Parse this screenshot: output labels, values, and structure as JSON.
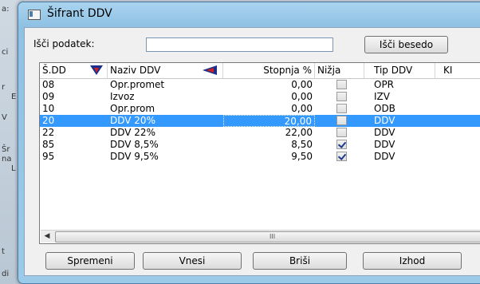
{
  "background": {
    "snippets": [
      "a:",
      "ci",
      "r",
      "E",
      "V",
      "Šr",
      "na",
      "L",
      "t",
      "di"
    ]
  },
  "window": {
    "title": "Šifrant DDV"
  },
  "search": {
    "label": "Išči podatek:",
    "value": "",
    "button": "Išči besedo"
  },
  "table": {
    "columns": [
      "Š.DD",
      "Naziv DDV",
      "Stopnja %",
      "Nižja",
      "Tip DDV",
      "KI"
    ],
    "rows": [
      {
        "code": "08",
        "name": "Opr.promet",
        "rate": "0,00",
        "lower": false,
        "type": "OPR",
        "selected": false
      },
      {
        "code": "09",
        "name": "Izvoz",
        "rate": "0,00",
        "lower": false,
        "type": "IZV",
        "selected": false
      },
      {
        "code": "10",
        "name": "Opr.prom",
        "rate": "0,00",
        "lower": false,
        "type": "ODB",
        "selected": false
      },
      {
        "code": "20",
        "name": "DDV 20%",
        "rate": "20,00",
        "lower": false,
        "type": "DDV",
        "selected": true
      },
      {
        "code": "22",
        "name": "DDV 22%",
        "rate": "22,00",
        "lower": false,
        "type": "DDV",
        "selected": false
      },
      {
        "code": "85",
        "name": "DDV 8,5%",
        "rate": "8,50",
        "lower": true,
        "type": "DDV",
        "selected": false
      },
      {
        "code": "95",
        "name": "DDV 9,5%",
        "rate": "9,50",
        "lower": true,
        "type": "DDV",
        "selected": false
      }
    ]
  },
  "buttons": {
    "edit": "Spremeni",
    "insert": "Vnesi",
    "delete": "Briši",
    "exit": "Izhod"
  },
  "scroll_grip": "III",
  "colors": {
    "selection": "#3399ff",
    "title_bar": "#9ccbe9",
    "sort_icon_blue": "#1c2f8c",
    "sort_icon_red": "#d02020"
  },
  "icons": {
    "sort_down": "sort-down-icon",
    "sort_left": "sort-left-icon"
  }
}
